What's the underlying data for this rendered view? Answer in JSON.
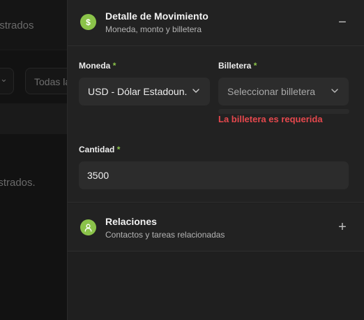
{
  "background": {
    "heading_fragment": "istrados",
    "filter_fragment": "Todas la",
    "empty_fragment": "istrados."
  },
  "detail_section": {
    "title": "Detalle de Movimiento",
    "subtitle": "Moneda, monto y billetera",
    "badge_icon": "dollar-icon",
    "toggle_glyph": "−",
    "accent_color": "#8bc34a"
  },
  "currency": {
    "label": "Moneda",
    "required_mark": "*",
    "selected": "USD - Dólar Estadoun..."
  },
  "wallet": {
    "label": "Billetera",
    "required_mark": "*",
    "placeholder": "Seleccionar billetera",
    "error": "La billetera es requerida",
    "error_color": "#e5484d"
  },
  "amount": {
    "label": "Cantidad",
    "required_mark": "*",
    "value": "3500"
  },
  "relations_section": {
    "title": "Relaciones",
    "subtitle": "Contactos y tareas relacionadas",
    "badge_icon": "user-icon",
    "toggle_glyph": "+"
  }
}
